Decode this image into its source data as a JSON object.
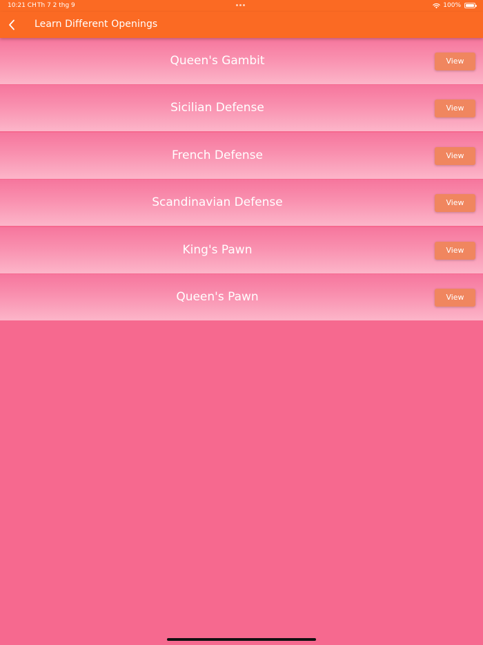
{
  "status_bar": {
    "time": "10:21 CH",
    "date": "Th 7 2 thg 9",
    "battery": "100%",
    "battery_level": 1.0
  },
  "app_bar": {
    "title": "Learn Different Openings",
    "back_icon": "chevron-left-icon"
  },
  "openings": [
    {
      "name": "Queen's Gambit",
      "button": "View"
    },
    {
      "name": "Sicilian Defense",
      "button": "View"
    },
    {
      "name": "French Defense",
      "button": "View"
    },
    {
      "name": "Scandinavian Defense",
      "button": "View"
    },
    {
      "name": "King's Pawn",
      "button": "View"
    },
    {
      "name": "Queen's Pawn",
      "button": "View"
    }
  ],
  "colors": {
    "app_bar": "#fb6a23",
    "background": "#f6698f",
    "view_button": "#f0865f",
    "row_top": "#f6769d",
    "row_bottom": "#fcb5c9"
  }
}
